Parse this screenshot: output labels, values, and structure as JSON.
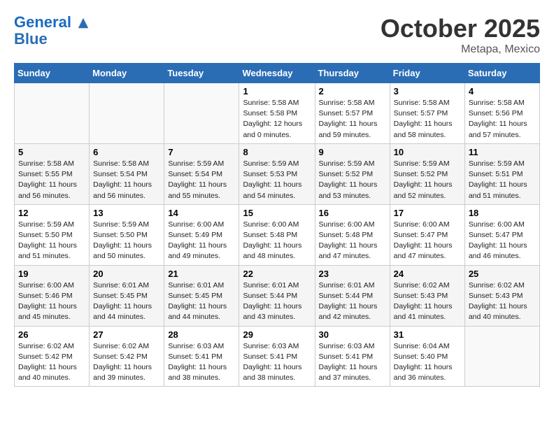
{
  "header": {
    "logo_line1": "General",
    "logo_line2": "Blue",
    "month": "October 2025",
    "location": "Metapa, Mexico"
  },
  "days_of_week": [
    "Sunday",
    "Monday",
    "Tuesday",
    "Wednesday",
    "Thursday",
    "Friday",
    "Saturday"
  ],
  "weeks": [
    [
      {
        "day": "",
        "info": []
      },
      {
        "day": "",
        "info": []
      },
      {
        "day": "",
        "info": []
      },
      {
        "day": "1",
        "info": [
          "Sunrise: 5:58 AM",
          "Sunset: 5:58 PM",
          "Daylight: 12 hours",
          "and 0 minutes."
        ]
      },
      {
        "day": "2",
        "info": [
          "Sunrise: 5:58 AM",
          "Sunset: 5:57 PM",
          "Daylight: 11 hours",
          "and 59 minutes."
        ]
      },
      {
        "day": "3",
        "info": [
          "Sunrise: 5:58 AM",
          "Sunset: 5:57 PM",
          "Daylight: 11 hours",
          "and 58 minutes."
        ]
      },
      {
        "day": "4",
        "info": [
          "Sunrise: 5:58 AM",
          "Sunset: 5:56 PM",
          "Daylight: 11 hours",
          "and 57 minutes."
        ]
      }
    ],
    [
      {
        "day": "5",
        "info": [
          "Sunrise: 5:58 AM",
          "Sunset: 5:55 PM",
          "Daylight: 11 hours",
          "and 56 minutes."
        ]
      },
      {
        "day": "6",
        "info": [
          "Sunrise: 5:58 AM",
          "Sunset: 5:54 PM",
          "Daylight: 11 hours",
          "and 56 minutes."
        ]
      },
      {
        "day": "7",
        "info": [
          "Sunrise: 5:59 AM",
          "Sunset: 5:54 PM",
          "Daylight: 11 hours",
          "and 55 minutes."
        ]
      },
      {
        "day": "8",
        "info": [
          "Sunrise: 5:59 AM",
          "Sunset: 5:53 PM",
          "Daylight: 11 hours",
          "and 54 minutes."
        ]
      },
      {
        "day": "9",
        "info": [
          "Sunrise: 5:59 AM",
          "Sunset: 5:52 PM",
          "Daylight: 11 hours",
          "and 53 minutes."
        ]
      },
      {
        "day": "10",
        "info": [
          "Sunrise: 5:59 AM",
          "Sunset: 5:52 PM",
          "Daylight: 11 hours",
          "and 52 minutes."
        ]
      },
      {
        "day": "11",
        "info": [
          "Sunrise: 5:59 AM",
          "Sunset: 5:51 PM",
          "Daylight: 11 hours",
          "and 51 minutes."
        ]
      }
    ],
    [
      {
        "day": "12",
        "info": [
          "Sunrise: 5:59 AM",
          "Sunset: 5:50 PM",
          "Daylight: 11 hours",
          "and 51 minutes."
        ]
      },
      {
        "day": "13",
        "info": [
          "Sunrise: 5:59 AM",
          "Sunset: 5:50 PM",
          "Daylight: 11 hours",
          "and 50 minutes."
        ]
      },
      {
        "day": "14",
        "info": [
          "Sunrise: 6:00 AM",
          "Sunset: 5:49 PM",
          "Daylight: 11 hours",
          "and 49 minutes."
        ]
      },
      {
        "day": "15",
        "info": [
          "Sunrise: 6:00 AM",
          "Sunset: 5:48 PM",
          "Daylight: 11 hours",
          "and 48 minutes."
        ]
      },
      {
        "day": "16",
        "info": [
          "Sunrise: 6:00 AM",
          "Sunset: 5:48 PM",
          "Daylight: 11 hours",
          "and 47 minutes."
        ]
      },
      {
        "day": "17",
        "info": [
          "Sunrise: 6:00 AM",
          "Sunset: 5:47 PM",
          "Daylight: 11 hours",
          "and 47 minutes."
        ]
      },
      {
        "day": "18",
        "info": [
          "Sunrise: 6:00 AM",
          "Sunset: 5:47 PM",
          "Daylight: 11 hours",
          "and 46 minutes."
        ]
      }
    ],
    [
      {
        "day": "19",
        "info": [
          "Sunrise: 6:00 AM",
          "Sunset: 5:46 PM",
          "Daylight: 11 hours",
          "and 45 minutes."
        ]
      },
      {
        "day": "20",
        "info": [
          "Sunrise: 6:01 AM",
          "Sunset: 5:45 PM",
          "Daylight: 11 hours",
          "and 44 minutes."
        ]
      },
      {
        "day": "21",
        "info": [
          "Sunrise: 6:01 AM",
          "Sunset: 5:45 PM",
          "Daylight: 11 hours",
          "and 44 minutes."
        ]
      },
      {
        "day": "22",
        "info": [
          "Sunrise: 6:01 AM",
          "Sunset: 5:44 PM",
          "Daylight: 11 hours",
          "and 43 minutes."
        ]
      },
      {
        "day": "23",
        "info": [
          "Sunrise: 6:01 AM",
          "Sunset: 5:44 PM",
          "Daylight: 11 hours",
          "and 42 minutes."
        ]
      },
      {
        "day": "24",
        "info": [
          "Sunrise: 6:02 AM",
          "Sunset: 5:43 PM",
          "Daylight: 11 hours",
          "and 41 minutes."
        ]
      },
      {
        "day": "25",
        "info": [
          "Sunrise: 6:02 AM",
          "Sunset: 5:43 PM",
          "Daylight: 11 hours",
          "and 40 minutes."
        ]
      }
    ],
    [
      {
        "day": "26",
        "info": [
          "Sunrise: 6:02 AM",
          "Sunset: 5:42 PM",
          "Daylight: 11 hours",
          "and 40 minutes."
        ]
      },
      {
        "day": "27",
        "info": [
          "Sunrise: 6:02 AM",
          "Sunset: 5:42 PM",
          "Daylight: 11 hours",
          "and 39 minutes."
        ]
      },
      {
        "day": "28",
        "info": [
          "Sunrise: 6:03 AM",
          "Sunset: 5:41 PM",
          "Daylight: 11 hours",
          "and 38 minutes."
        ]
      },
      {
        "day": "29",
        "info": [
          "Sunrise: 6:03 AM",
          "Sunset: 5:41 PM",
          "Daylight: 11 hours",
          "and 38 minutes."
        ]
      },
      {
        "day": "30",
        "info": [
          "Sunrise: 6:03 AM",
          "Sunset: 5:41 PM",
          "Daylight: 11 hours",
          "and 37 minutes."
        ]
      },
      {
        "day": "31",
        "info": [
          "Sunrise: 6:04 AM",
          "Sunset: 5:40 PM",
          "Daylight: 11 hours",
          "and 36 minutes."
        ]
      },
      {
        "day": "",
        "info": []
      }
    ]
  ]
}
